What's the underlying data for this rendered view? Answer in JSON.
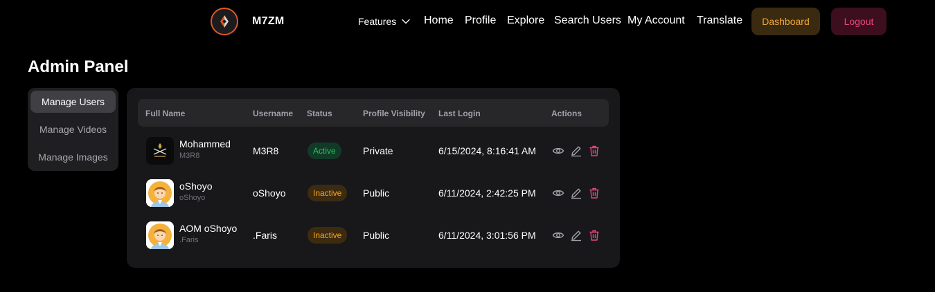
{
  "header": {
    "brand": "M7ZM",
    "nav": {
      "features": "Features",
      "home": "Home",
      "profile": "Profile",
      "explore": "Explore",
      "search_users": "Search Users",
      "my_account": "My Account",
      "translate": "Translate"
    },
    "dashboard_label": "Dashboard",
    "logout_label": "Logout"
  },
  "page_title": "Admin Panel",
  "sidebar": {
    "items": [
      {
        "label": "Manage Users",
        "active": true
      },
      {
        "label": "Manage Videos",
        "active": false
      },
      {
        "label": "Manage Images",
        "active": false
      }
    ]
  },
  "table": {
    "headers": {
      "full_name": "Full Name",
      "username": "Username",
      "status": "Status",
      "visibility": "Profile Visibility",
      "last_login": "Last Login",
      "actions": "Actions"
    },
    "rows": [
      {
        "full_name": "Mohammed",
        "handle": "M3R8",
        "username": "M3R8",
        "status": "Active",
        "visibility": "Private",
        "last_login": "6/15/2024, 8:16:41 AM",
        "avatar": "emblem-avatar"
      },
      {
        "full_name": "oShoyo",
        "handle": "oShoyo",
        "username": "oShoyo",
        "status": "Inactive",
        "visibility": "Public",
        "last_login": "6/11/2024, 2:42:25 PM",
        "avatar": "cartoon-person-avatar"
      },
      {
        "full_name": "AOM oShoyo",
        "handle": ".Faris",
        "username": ".Faris",
        "status": "Inactive",
        "visibility": "Public",
        "last_login": "6/11/2024, 3:01:56 PM",
        "avatar": "cartoon-person-avatar"
      }
    ]
  },
  "icons": {
    "view": "eye-icon",
    "edit": "pencil-icon",
    "delete": "trash-icon",
    "dropdown": "chevron-down-icon"
  },
  "colors": {
    "accent_orange": "#e2551f",
    "dashboard_text": "#f1a83a",
    "logout_text": "#e9457c",
    "active_green": "#22c55e",
    "inactive_amber": "#f5a524",
    "delete_red": "#e9457c"
  }
}
